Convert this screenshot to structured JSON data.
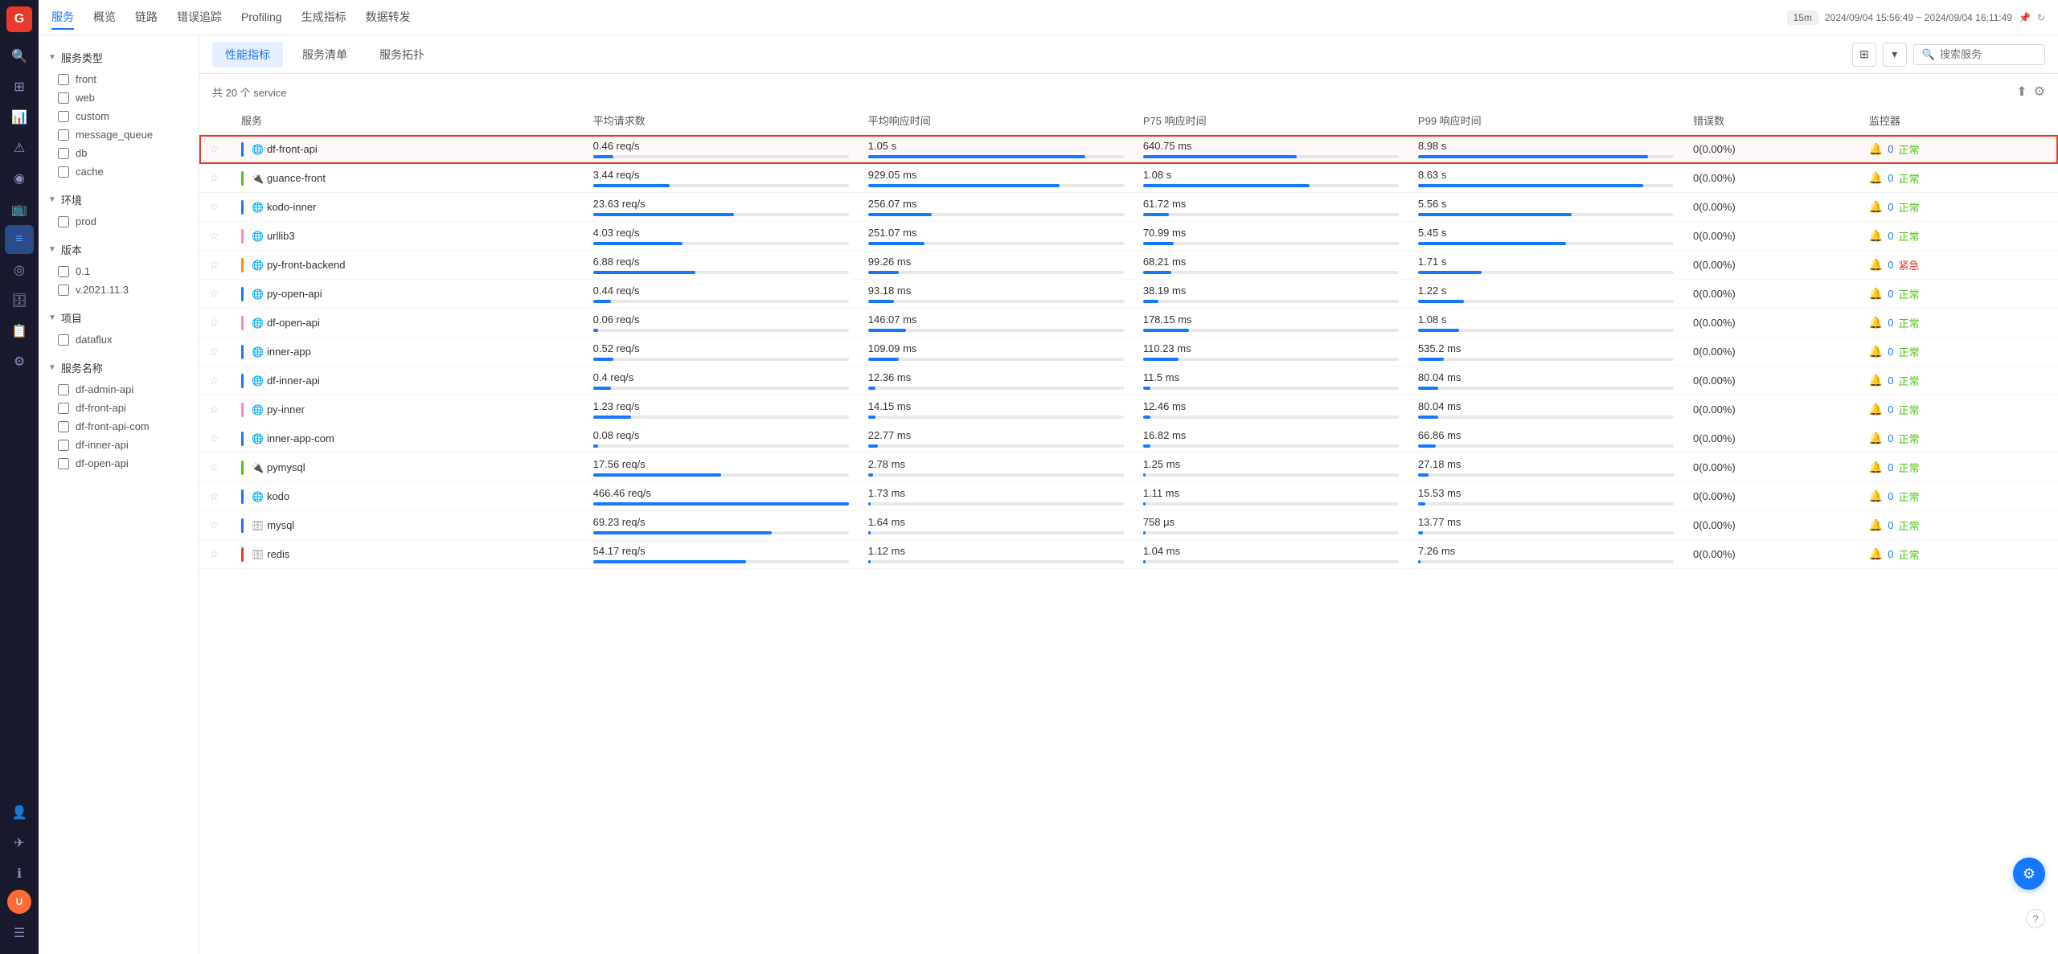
{
  "app": {
    "logo": "G",
    "nav_items": [
      "服务",
      "概览",
      "链路",
      "错误追踪",
      "Profiling",
      "生成指标",
      "数据转发"
    ],
    "active_nav": "服务",
    "time_range": "15m",
    "time_start": "2024/09/04 15:56:49",
    "time_end": "2024/09/04 16:11:49"
  },
  "sidebar_icons": [
    {
      "name": "search-icon",
      "symbol": "🔍"
    },
    {
      "name": "dashboard-icon",
      "symbol": "⊞"
    },
    {
      "name": "chart-icon",
      "symbol": "📊"
    },
    {
      "name": "alert-icon",
      "symbol": "⚠"
    },
    {
      "name": "topology-icon",
      "symbol": "◉"
    },
    {
      "name": "monitor-icon",
      "symbol": "📺"
    },
    {
      "name": "service-icon",
      "symbol": "≡",
      "active": true
    },
    {
      "name": "target-icon",
      "symbol": "◎"
    },
    {
      "name": "db-icon",
      "symbol": "🗄"
    },
    {
      "name": "log-icon",
      "symbol": "📋"
    },
    {
      "name": "settings-icon",
      "symbol": "⚙"
    },
    {
      "name": "user-icon",
      "symbol": "👤"
    },
    {
      "name": "send-icon",
      "symbol": "✈"
    },
    {
      "name": "info-icon",
      "symbol": "ℹ"
    },
    {
      "name": "menu-icon",
      "symbol": "☰"
    }
  ],
  "sub_tabs": [
    "性能指标",
    "服务清单",
    "服务拓扑"
  ],
  "active_sub_tab": "性能指标",
  "search_placeholder": "搜索服务",
  "filter": {
    "service_type_label": "服务类型",
    "service_types": [
      "front",
      "web",
      "custom",
      "message_queue",
      "db",
      "cache"
    ],
    "env_label": "环境",
    "envs": [
      "prod"
    ],
    "version_label": "版本",
    "versions": [
      "0.1",
      "v.2021.11.3"
    ],
    "project_label": "项目",
    "projects": [
      "dataflux"
    ],
    "service_name_label": "服务名称",
    "service_names": [
      "df-admin-api",
      "df-front-api",
      "df-front-api-com",
      "df-inner-api",
      "df-open-api"
    ]
  },
  "table": {
    "total_label": "共 20 个 service",
    "columns": [
      "服务",
      "平均请求数",
      "平均响应时间",
      "P75 响应时间",
      "P99 响应时间",
      "错误数",
      "监控器"
    ],
    "rows": [
      {
        "starred": false,
        "color": "#1677ff",
        "icon": "globe",
        "name": "df-front-api",
        "avg_req": "0.46 req/s",
        "avg_req_bar": 8,
        "avg_resp": "1.05 s",
        "avg_resp_bar": 85,
        "p75": "640.75 ms",
        "p75_bar": 60,
        "p99": "8.98 s",
        "p99_bar": 90,
        "errors": "0(0.00%)",
        "monitor_count": "0",
        "status": "正常",
        "status_type": "normal",
        "highlighted": true
      },
      {
        "starred": false,
        "color": "#52c41a",
        "icon": "plug",
        "name": "guance-front",
        "avg_req": "3.44 req/s",
        "avg_req_bar": 30,
        "avg_resp": "929.05 ms",
        "avg_resp_bar": 75,
        "p75": "1.08 s",
        "p75_bar": 65,
        "p99": "8.63 s",
        "p99_bar": 88,
        "errors": "0(0.00%)",
        "monitor_count": "0",
        "status": "正常",
        "status_type": "normal",
        "highlighted": false
      },
      {
        "starred": false,
        "color": "#1677ff",
        "icon": "globe",
        "name": "kodo-inner",
        "avg_req": "23.63 req/s",
        "avg_req_bar": 55,
        "avg_resp": "256.07 ms",
        "avg_resp_bar": 25,
        "p75": "61.72 ms",
        "p75_bar": 10,
        "p99": "5.56 s",
        "p99_bar": 60,
        "errors": "0(0.00%)",
        "monitor_count": "0",
        "status": "正常",
        "status_type": "normal",
        "highlighted": false
      },
      {
        "starred": false,
        "color": "#ff85c2",
        "icon": "globe",
        "name": "urllib3",
        "avg_req": "4.03 req/s",
        "avg_req_bar": 35,
        "avg_resp": "251.07 ms",
        "avg_resp_bar": 22,
        "p75": "70.99 ms",
        "p75_bar": 12,
        "p99": "5.45 s",
        "p99_bar": 58,
        "errors": "0(0.00%)",
        "monitor_count": "0",
        "status": "正常",
        "status_type": "normal",
        "highlighted": false
      },
      {
        "starred": false,
        "color": "#fa8c16",
        "icon": "globe",
        "name": "py-front-backend",
        "avg_req": "6.88 req/s",
        "avg_req_bar": 40,
        "avg_resp": "99.26 ms",
        "avg_resp_bar": 12,
        "p75": "68.21 ms",
        "p75_bar": 11,
        "p99": "1.71 s",
        "p99_bar": 25,
        "errors": "0(0.00%)",
        "monitor_count": "0",
        "status": "紧急",
        "status_type": "urgent",
        "highlighted": false
      },
      {
        "starred": false,
        "color": "#1677ff",
        "icon": "globe",
        "name": "py-open-api",
        "avg_req": "0.44 req/s",
        "avg_req_bar": 7,
        "avg_resp": "93.18 ms",
        "avg_resp_bar": 10,
        "p75": "38.19 ms",
        "p75_bar": 6,
        "p99": "1.22 s",
        "p99_bar": 18,
        "errors": "0(0.00%)",
        "monitor_count": "0",
        "status": "正常",
        "status_type": "normal",
        "highlighted": false
      },
      {
        "starred": false,
        "color": "#ff85c2",
        "icon": "globe",
        "name": "df-open-api",
        "avg_req": "0.06 req/s",
        "avg_req_bar": 2,
        "avg_resp": "146.07 ms",
        "avg_resp_bar": 15,
        "p75": "178.15 ms",
        "p75_bar": 18,
        "p99": "1.08 s",
        "p99_bar": 16,
        "errors": "0(0.00%)",
        "monitor_count": "0",
        "status": "正常",
        "status_type": "normal",
        "highlighted": false
      },
      {
        "starred": false,
        "color": "#1677ff",
        "icon": "globe",
        "name": "inner-app",
        "avg_req": "0.52 req/s",
        "avg_req_bar": 8,
        "avg_resp": "109.09 ms",
        "avg_resp_bar": 12,
        "p75": "110.23 ms",
        "p75_bar": 14,
        "p99": "535.2 ms",
        "p99_bar": 10,
        "errors": "0(0.00%)",
        "monitor_count": "0",
        "status": "正常",
        "status_type": "normal",
        "highlighted": false
      },
      {
        "starred": false,
        "color": "#1677ff",
        "icon": "globe",
        "name": "df-inner-api",
        "avg_req": "0.4 req/s",
        "avg_req_bar": 7,
        "avg_resp": "12.36 ms",
        "avg_resp_bar": 3,
        "p75": "11.5 ms",
        "p75_bar": 3,
        "p99": "80.04 ms",
        "p99_bar": 8,
        "errors": "0(0.00%)",
        "monitor_count": "0",
        "status": "正常",
        "status_type": "normal",
        "highlighted": false
      },
      {
        "starred": false,
        "color": "#ff85c2",
        "icon": "globe",
        "name": "py-inner",
        "avg_req": "1.23 req/s",
        "avg_req_bar": 15,
        "avg_resp": "14.15 ms",
        "avg_resp_bar": 3,
        "p75": "12.46 ms",
        "p75_bar": 3,
        "p99": "80.04 ms",
        "p99_bar": 8,
        "errors": "0(0.00%)",
        "monitor_count": "0",
        "status": "正常",
        "status_type": "normal",
        "highlighted": false
      },
      {
        "starred": false,
        "color": "#1677ff",
        "icon": "globe",
        "name": "inner-app-com",
        "avg_req": "0.08 req/s",
        "avg_req_bar": 2,
        "avg_resp": "22.77 ms",
        "avg_resp_bar": 4,
        "p75": "16.82 ms",
        "p75_bar": 3,
        "p99": "66.86 ms",
        "p99_bar": 7,
        "errors": "0(0.00%)",
        "monitor_count": "0",
        "status": "正常",
        "status_type": "normal",
        "highlighted": false
      },
      {
        "starred": false,
        "color": "#52c41a",
        "icon": "plug",
        "name": "pymysql",
        "avg_req": "17.56 req/s",
        "avg_req_bar": 50,
        "avg_resp": "2.78 ms",
        "avg_resp_bar": 2,
        "p75": "1.25 ms",
        "p75_bar": 1,
        "p99": "27.18 ms",
        "p99_bar": 4,
        "errors": "0(0.00%)",
        "monitor_count": "0",
        "status": "正常",
        "status_type": "normal",
        "highlighted": false
      },
      {
        "starred": false,
        "color": "#1677ff",
        "icon": "globe",
        "name": "kodo",
        "avg_req": "466.46 req/s",
        "avg_req_bar": 100,
        "avg_resp": "1.73 ms",
        "avg_resp_bar": 1,
        "p75": "1.11 ms",
        "p75_bar": 1,
        "p99": "15.53 ms",
        "p99_bar": 3,
        "errors": "0(0.00%)",
        "monitor_count": "0",
        "status": "正常",
        "status_type": "normal",
        "highlighted": false
      },
      {
        "starred": false,
        "color": "#1677ff",
        "icon": "db",
        "name": "mysql",
        "avg_req": "69.23 req/s",
        "avg_req_bar": 70,
        "avg_resp": "1.64 ms",
        "avg_resp_bar": 1,
        "p75": "758 μs",
        "p75_bar": 1,
        "p99": "13.77 ms",
        "p99_bar": 2,
        "errors": "0(0.00%)",
        "monitor_count": "0",
        "status": "正常",
        "status_type": "normal",
        "highlighted": false
      },
      {
        "starred": false,
        "color": "#e8392a",
        "icon": "db",
        "name": "redis",
        "avg_req": "54.17 req/s",
        "avg_req_bar": 60,
        "avg_resp": "1.12 ms",
        "avg_resp_bar": 1,
        "p75": "1.04 ms",
        "p75_bar": 1,
        "p99": "7.26 ms",
        "p99_bar": 1,
        "errors": "0(0.00%)",
        "monitor_count": "0",
        "status": "正常",
        "status_type": "normal",
        "highlighted": false
      }
    ]
  }
}
